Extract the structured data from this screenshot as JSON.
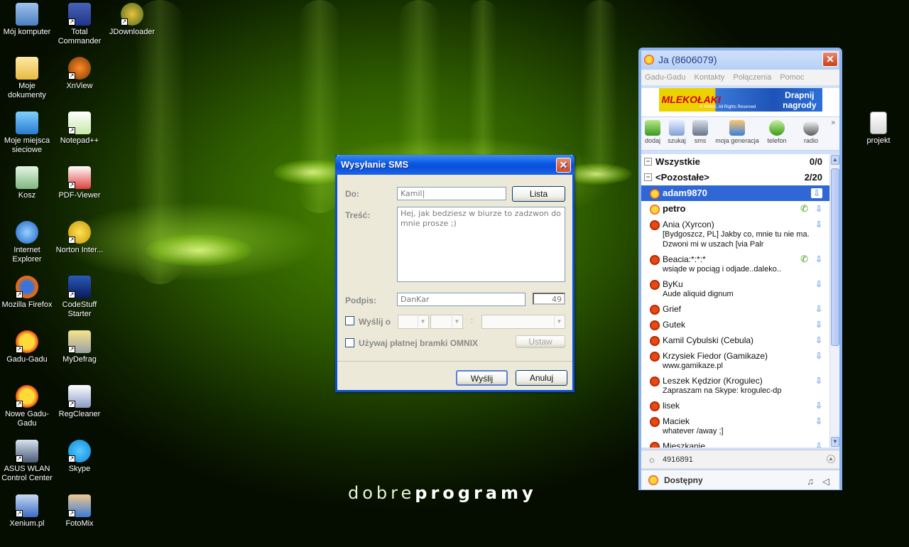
{
  "desktop": {
    "icons": [
      {
        "label": "Mój komputer"
      },
      {
        "label": "Total Commander"
      },
      {
        "label": "JDownloader"
      },
      {
        "label": "Moje dokumenty"
      },
      {
        "label": "XnView"
      },
      {
        "label": "Moje miejsca sieciowe"
      },
      {
        "label": "Notepad++"
      },
      {
        "label": "Kosz"
      },
      {
        "label": "PDF-Viewer"
      },
      {
        "label": "Internet Explorer"
      },
      {
        "label": "Norton Inter..."
      },
      {
        "label": "Mozilla Firefox"
      },
      {
        "label": "CodeStuff Starter"
      },
      {
        "label": "Gadu-Gadu"
      },
      {
        "label": "MyDefrag"
      },
      {
        "label": "Nowe Gadu-Gadu"
      },
      {
        "label": "RegCleaner"
      },
      {
        "label": "ASUS WLAN Control Center"
      },
      {
        "label": "Skype"
      },
      {
        "label": "Xenium.pl"
      },
      {
        "label": "FotoMix"
      },
      {
        "label": "projekt"
      }
    ],
    "watermark_light": "dobre",
    "watermark_bold": "programy"
  },
  "sms_dialog": {
    "title": "Wysyłanie SMS",
    "to_label": "Do:",
    "to_value": "Kamil",
    "list_button": "Lista",
    "content_label": "Treść:",
    "content_value": "Hej, jak bedziesz w biurze to zadzwon do mnie prosze ;)",
    "signature_label": "Podpis:",
    "signature_value": "DanKar",
    "char_count": "49",
    "send_at_label": "Wyślij o",
    "time_separator": ":",
    "omnix_label": "Używaj płatnej bramki OMNIX",
    "set_button": "Ustaw",
    "send_button": "Wyślij",
    "cancel_button": "Anuluj"
  },
  "gg": {
    "title": "Ja (8606079)",
    "menu": [
      "Gadu-Gadu",
      "Kontakty",
      "Połączenia",
      "Pomoc"
    ],
    "banner_left": "MLEKOŁAKI",
    "banner_right_1": "Drapnij",
    "banner_right_2": "nagrody",
    "banner_small": "© PAWS. All Rights Reserved",
    "toolbar": [
      "dodaj",
      "szukaj",
      "sms",
      "moja generacja",
      "telefon",
      "radio"
    ],
    "groups": [
      {
        "name": "Wszystkie",
        "count": "0/0"
      },
      {
        "name": "<Pozostałe>",
        "count": "2/20"
      }
    ],
    "contacts": [
      {
        "name": "adam9870",
        "desc": ""
      },
      {
        "name": "petro",
        "desc": ""
      },
      {
        "name": "Ania (Xyrcon)",
        "desc": "[Bydgoszcz, PL] Jakby co, mnie tu nie ma. Dzwoni mi w uszach [via Palr"
      },
      {
        "name": "Beacia:*:*:*",
        "desc": "wsiąde w pociąg i odjade..daleko.."
      },
      {
        "name": "ByKu",
        "desc": "Aude aliquid dignum"
      },
      {
        "name": "Grief",
        "desc": ""
      },
      {
        "name": "Gutek",
        "desc": ""
      },
      {
        "name": "Kamil Cybulski (Cebula)",
        "desc": ""
      },
      {
        "name": "Krzysiek Fiedor (Gamikaze)",
        "desc": "www.gamikaze.pl"
      },
      {
        "name": "Leszek Kędzior (Krogulec)",
        "desc": "Zapraszam na Skype: krogulec-dp"
      },
      {
        "name": "lisek",
        "desc": ""
      },
      {
        "name": "Maciek",
        "desc": "whatever /away ;]"
      },
      {
        "name": "Mieszkanie",
        "desc": ""
      }
    ],
    "status_number": "4916891",
    "status": "Dostępny",
    "colors": {
      "accent": "#2f67d6",
      "title_blue": "#0a4fd9"
    }
  }
}
